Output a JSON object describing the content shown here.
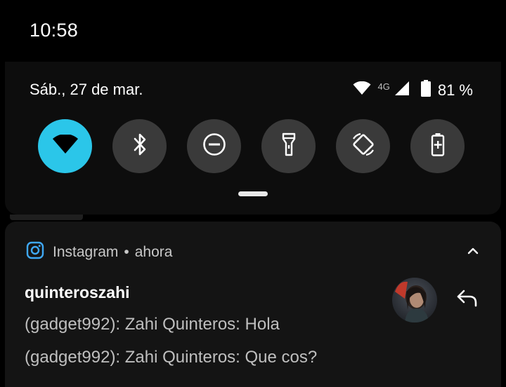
{
  "status_bar": {
    "time": "10:58"
  },
  "quick_settings": {
    "date": "Sáb., 27 de mar.",
    "network_type": "4G",
    "battery_percent": "81 %",
    "tiles": [
      {
        "name": "wifi",
        "icon": "wifi-icon",
        "active": true
      },
      {
        "name": "bluetooth",
        "icon": "bluetooth-icon",
        "active": false
      },
      {
        "name": "do-not-disturb",
        "icon": "do-not-disturb-icon",
        "active": false
      },
      {
        "name": "flashlight",
        "icon": "flashlight-icon",
        "active": false
      },
      {
        "name": "auto-rotate",
        "icon": "auto-rotate-icon",
        "active": false
      },
      {
        "name": "battery-saver",
        "icon": "battery-saver-icon",
        "active": false
      }
    ],
    "active_color": "#2bc6e9"
  },
  "notification": {
    "app_name": "Instagram",
    "separator": "•",
    "time": "ahora",
    "sender": "quinteroszahi",
    "messages": [
      "(gadget992): Zahi Quinteros: Hola",
      "(gadget992): Zahi Quinteros: Que cos?"
    ],
    "accent_color": "#3fa8f5"
  }
}
